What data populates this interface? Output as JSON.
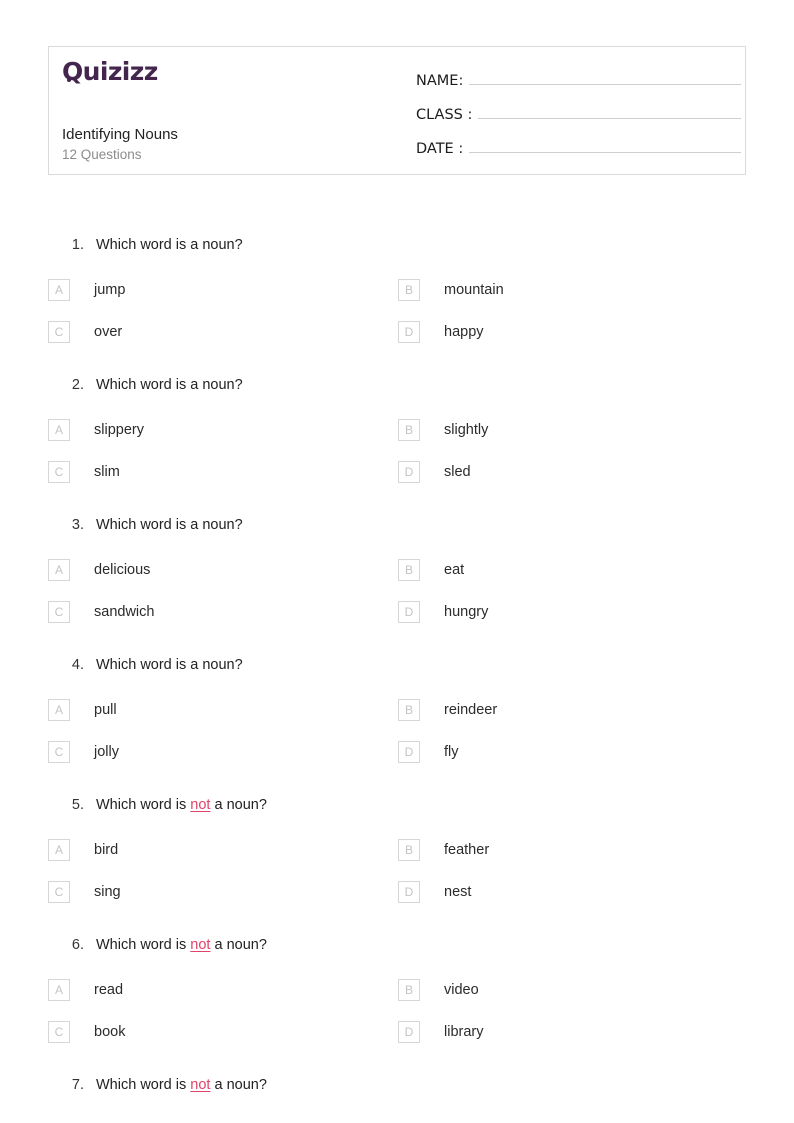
{
  "header": {
    "logo_text": "Quizizz",
    "logo_color": "#43254d",
    "title": "Identifying Nouns",
    "subtitle": "12 Questions",
    "fields": [
      {
        "label": "NAME:"
      },
      {
        "label": "CLASS :"
      },
      {
        "label": "DATE  :"
      }
    ]
  },
  "highlight_color": "#e0446a",
  "questions": [
    {
      "number": "1.",
      "prefix": "Which word is a noun?",
      "negated": false,
      "options": [
        {
          "letter": "A",
          "text": "jump"
        },
        {
          "letter": "B",
          "text": "mountain"
        },
        {
          "letter": "C",
          "text": "over"
        },
        {
          "letter": "D",
          "text": "happy"
        }
      ]
    },
    {
      "number": "2.",
      "prefix": "Which word is a noun?",
      "negated": false,
      "options": [
        {
          "letter": "A",
          "text": "slippery"
        },
        {
          "letter": "B",
          "text": "slightly"
        },
        {
          "letter": "C",
          "text": "slim"
        },
        {
          "letter": "D",
          "text": "sled"
        }
      ]
    },
    {
      "number": "3.",
      "prefix": "Which word is a noun?",
      "negated": false,
      "options": [
        {
          "letter": "A",
          "text": "delicious"
        },
        {
          "letter": "B",
          "text": "eat"
        },
        {
          "letter": "C",
          "text": "sandwich"
        },
        {
          "letter": "D",
          "text": "hungry"
        }
      ]
    },
    {
      "number": "4.",
      "prefix": "Which word is a noun?",
      "negated": false,
      "options": [
        {
          "letter": "A",
          "text": "pull"
        },
        {
          "letter": "B",
          "text": "reindeer"
        },
        {
          "letter": "C",
          "text": "jolly"
        },
        {
          "letter": "D",
          "text": "fly"
        }
      ]
    },
    {
      "number": "5.",
      "prefix": "Which word is ",
      "negated": true,
      "negated_word": "not",
      "suffix": " a noun?",
      "options": [
        {
          "letter": "A",
          "text": "bird"
        },
        {
          "letter": "B",
          "text": "feather"
        },
        {
          "letter": "C",
          "text": "sing"
        },
        {
          "letter": "D",
          "text": "nest"
        }
      ]
    },
    {
      "number": "6.",
      "prefix": "Which word is ",
      "negated": true,
      "negated_word": "not",
      "suffix": " a noun?",
      "options": [
        {
          "letter": "A",
          "text": "read"
        },
        {
          "letter": "B",
          "text": "video"
        },
        {
          "letter": "C",
          "text": "book"
        },
        {
          "letter": "D",
          "text": "library"
        }
      ]
    },
    {
      "number": "7.",
      "prefix": "Which word is ",
      "negated": true,
      "negated_word": "not",
      "suffix": " a noun?",
      "partial": true,
      "options": []
    }
  ]
}
